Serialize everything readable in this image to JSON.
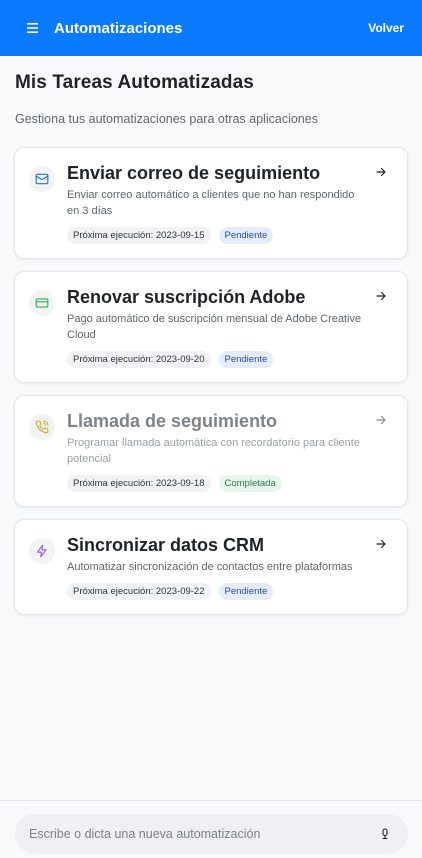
{
  "header": {
    "title": "Automatizaciones",
    "back_label": "Volver",
    "menu_icon": "hamburger-menu-icon",
    "bg_color": "#0a7bff"
  },
  "page": {
    "title": "Mis Tareas Automatizadas",
    "subtitle": "Gestiona tus automatizaciones para otras aplicaciones"
  },
  "tasks": [
    {
      "icon": "mail-icon",
      "icon_color": "#2f6fe0",
      "title": "Enviar correo de seguimiento",
      "description": "Enviar correo automático a clientes que no han respondido en 3 días",
      "next_run": "Próxima ejecución: 2023-09-15",
      "status": "Pendiente",
      "completed": false
    },
    {
      "icon": "credit-card-icon",
      "icon_color": "#2bb24c",
      "title": "Renovar suscripción Adobe",
      "description": "Pago automático de suscripción mensual de Adobe Creative Cloud",
      "next_run": "Próxima ejecución: 2023-09-20",
      "status": "Pendiente",
      "completed": false
    },
    {
      "icon": "phone-call-icon",
      "icon_color": "#e3a72f",
      "title": "Llamada de seguimiento",
      "description": "Programar llamada automática con recordatorio para cliente potencial",
      "next_run": "Próxima ejecución: 2023-09-18",
      "status": "Completada",
      "completed": true
    },
    {
      "icon": "lightning-icon",
      "icon_color": "#9b59d9",
      "title": "Sincronizar datos CRM",
      "description": "Automatizar sincronización de contactos entre plataformas",
      "next_run": "Próxima ejecución: 2023-09-22",
      "status": "Pendiente",
      "completed": false
    }
  ],
  "composer": {
    "placeholder": "Escribe o dicta una nueva automatización",
    "mic_icon": "microphone-icon"
  }
}
